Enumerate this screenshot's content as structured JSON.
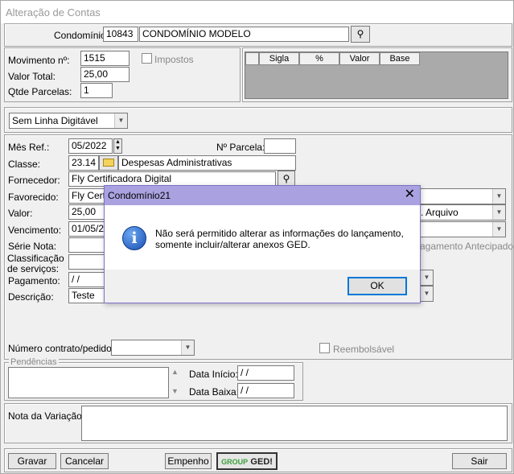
{
  "window": {
    "title": "Alteração de Contas"
  },
  "condominio": {
    "label": "Condomínio:",
    "code": "10843",
    "name": "CONDOMÍNIO MODELO"
  },
  "movimento": {
    "movimento_label": "Movimento nº:",
    "movimento_value": "1515",
    "valor_label": "Valor Total:",
    "valor_value": "25,00",
    "parcelas_label": "Qtde Parcelas:",
    "parcelas_value": "1",
    "impostos_label": "Impostos"
  },
  "tax_grid": {
    "headers": [
      "Sigla",
      "%",
      "Valor",
      "Base"
    ]
  },
  "linha_digitavel": {
    "value": "Sem Linha Digitável"
  },
  "form": {
    "mes_ref_label": "Mês Ref.:",
    "mes_ref_value": "05/2022",
    "nparcela_label": "Nº Parcela:",
    "nparcela_value": "",
    "classe_label": "Classe:",
    "classe_code": "23.14",
    "classe_name": "Despesas Administrativas",
    "fornecedor_label": "Fornecedor:",
    "fornecedor_value": "Fly Certificadora Digital",
    "favorecido_label": "Favorecido:",
    "favorecido_value": "Fly Certif",
    "valor_label": "Valor:",
    "valor_value": "25,00",
    "arquivo_value": ". Arquivo",
    "vencimento_label": "Vencimento:",
    "vencimento_value": "01/05/20",
    "serie_label": "Série Nota:",
    "pagamento_antecipado_label": "agamento Antecipado",
    "classificacao_label_1": "Classificação",
    "classificacao_label_2": "de serviços:",
    "pagamento_label": "Pagamento:",
    "pagamento_value": " / /",
    "descricao_label": "Descrição:",
    "descricao_value": "Teste",
    "contrato_label": "Número contrato/pedido:",
    "reembolsavel_label": "Reembolsável"
  },
  "pendencias": {
    "legend": "Pendências",
    "data_inicio_label": "Data Início:",
    "data_inicio_value": " / /",
    "data_baixa_label": "Data Baixa:",
    "data_baixa_value": " / /"
  },
  "nota": {
    "label": "Nota da Variação:"
  },
  "footer": {
    "gravar": "Gravar",
    "cancelar": "Cancelar",
    "empenho": "Empenho",
    "ged_group": "GROUP",
    "ged_text": "GED!",
    "sair": "Sair"
  },
  "dialog": {
    "title": "Condomínio21",
    "message_line1": "Não será permitido alterar as informações do lançamento,",
    "message_line2": "somente incluir/alterar anexos GED.",
    "ok": "OK",
    "close_glyph": "✕"
  },
  "colors": {
    "dialog_title_bg": "#aaa2e0",
    "ok_border": "#0078d7",
    "ged_green": "#3aa03a"
  }
}
